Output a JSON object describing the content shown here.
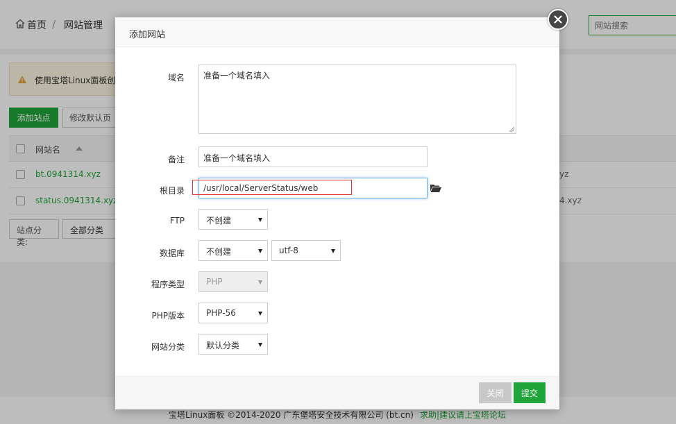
{
  "breadcrumb": {
    "home": "首页",
    "separator": "/",
    "current": "网站管理"
  },
  "search": {
    "placeholder": "网站搜索"
  },
  "notice": {
    "text": "使用宝塔Linux面板创"
  },
  "toolbar": {
    "add_site": "添加站点",
    "default_page": "修改默认页"
  },
  "table": {
    "header": "网站名",
    "rows": [
      {
        "name": "bt.0941314.xyz",
        "tail": "yz"
      },
      {
        "name": "status.0941314.xyz",
        "tail": "4.xyz"
      }
    ]
  },
  "category_filter": {
    "label": "站点分类:",
    "value": "全部分类"
  },
  "footer": {
    "copyright": "宝塔Linux面板 ©2014-2020 广东堡塔安全技术有限公司 (bt.cn)",
    "forum": "求助|建议请上宝塔论坛"
  },
  "modal": {
    "title": "添加网站",
    "fields": {
      "domain": {
        "label": "域名",
        "value": "准备一个域名填入"
      },
      "remark": {
        "label": "备注",
        "value": "准备一个域名填入"
      },
      "root": {
        "label": "根目录",
        "value": "/usr/local/ServerStatus/web"
      },
      "ftp": {
        "label": "FTP",
        "value": "不创建"
      },
      "database": {
        "label": "数据库",
        "value": "不创建",
        "charset": "utf-8"
      },
      "program_type": {
        "label": "程序类型",
        "value": "PHP"
      },
      "php_version": {
        "label": "PHP版本",
        "value": "PHP-56"
      },
      "site_category": {
        "label": "网站分类",
        "value": "默认分类"
      }
    },
    "buttons": {
      "cancel": "关闭",
      "submit": "提交"
    }
  },
  "colors": {
    "accent": "#20a53a",
    "highlight": "#e0312f",
    "focus": "#66afe9"
  }
}
